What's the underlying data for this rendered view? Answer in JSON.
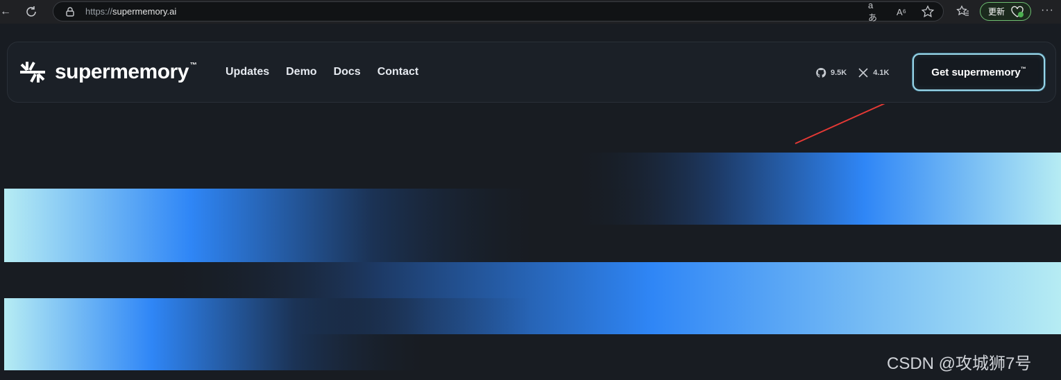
{
  "browser": {
    "url_scheme": "https://",
    "url_host": "supermemory.ai",
    "update_label": "更新",
    "read_aloud_glyph": "A⁶",
    "translate_glyph": "aあ",
    "more_glyph": "···",
    "back_glyph": "←"
  },
  "site": {
    "brand": "supermemory",
    "brand_tm": "™",
    "nav": [
      "Updates",
      "Demo",
      "Docs",
      "Contact"
    ],
    "github_stars": "9.5K",
    "x_followers": "4.1K",
    "cta_label": "Get supermemory",
    "cta_tm": "™"
  },
  "colors": {
    "accent_blue": "#2f86f6",
    "accent_cyan": "#b6ecf3",
    "background": "#181c22",
    "annotation_red": "#e53935"
  },
  "watermark": "CSDN @攻城狮7号"
}
